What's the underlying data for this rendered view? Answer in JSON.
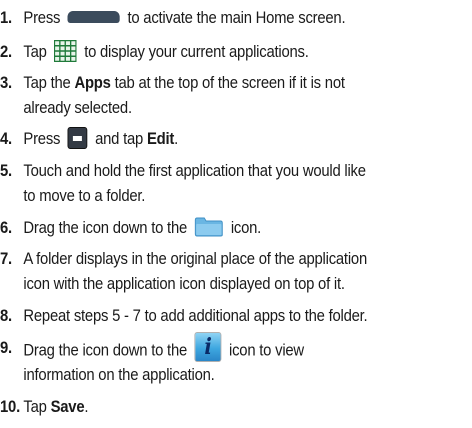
{
  "steps": [
    {
      "num": "1.",
      "a": "Press",
      "b": "to activate the main Home screen."
    },
    {
      "num": "2.",
      "a": "Tap",
      "b": "to display your current applications."
    },
    {
      "num": "3.",
      "a": "Tap the",
      "bold": "Apps",
      "b": "tab at the top of the screen if it is not",
      "c": "already selected."
    },
    {
      "num": "4.",
      "a": "Press",
      "b": "and tap",
      "bold": "Edit",
      "end": "."
    },
    {
      "num": "5.",
      "a": "Touch and hold the first application that you would like",
      "c": "to move to a folder."
    },
    {
      "num": "6.",
      "a": "Drag the icon down to the",
      "b": "icon."
    },
    {
      "num": "7.",
      "a": "A folder displays in the original place of the application",
      "c": "icon with the application icon displayed on top of it."
    },
    {
      "num": "8.",
      "a": "Repeat steps 5 - 7 to add additional apps to the folder."
    },
    {
      "num": "9.",
      "a": "Drag the icon down to the",
      "b": "icon to view",
      "c": "information on the application."
    },
    {
      "num": "10.",
      "a": "Tap",
      "bold": "Save",
      "end": "."
    }
  ],
  "icons": {
    "home_key": "home-key-icon",
    "apps_grid": "apps-grid-icon",
    "menu_key": "menu-key-icon",
    "folder": "folder-icon",
    "info": "info-icon",
    "info_glyph": "i"
  },
  "colors": {
    "text": "#1a1a1a",
    "grid": "#1f7a3a",
    "folder": "#6ab6e3",
    "key": "#3b4b5c"
  }
}
